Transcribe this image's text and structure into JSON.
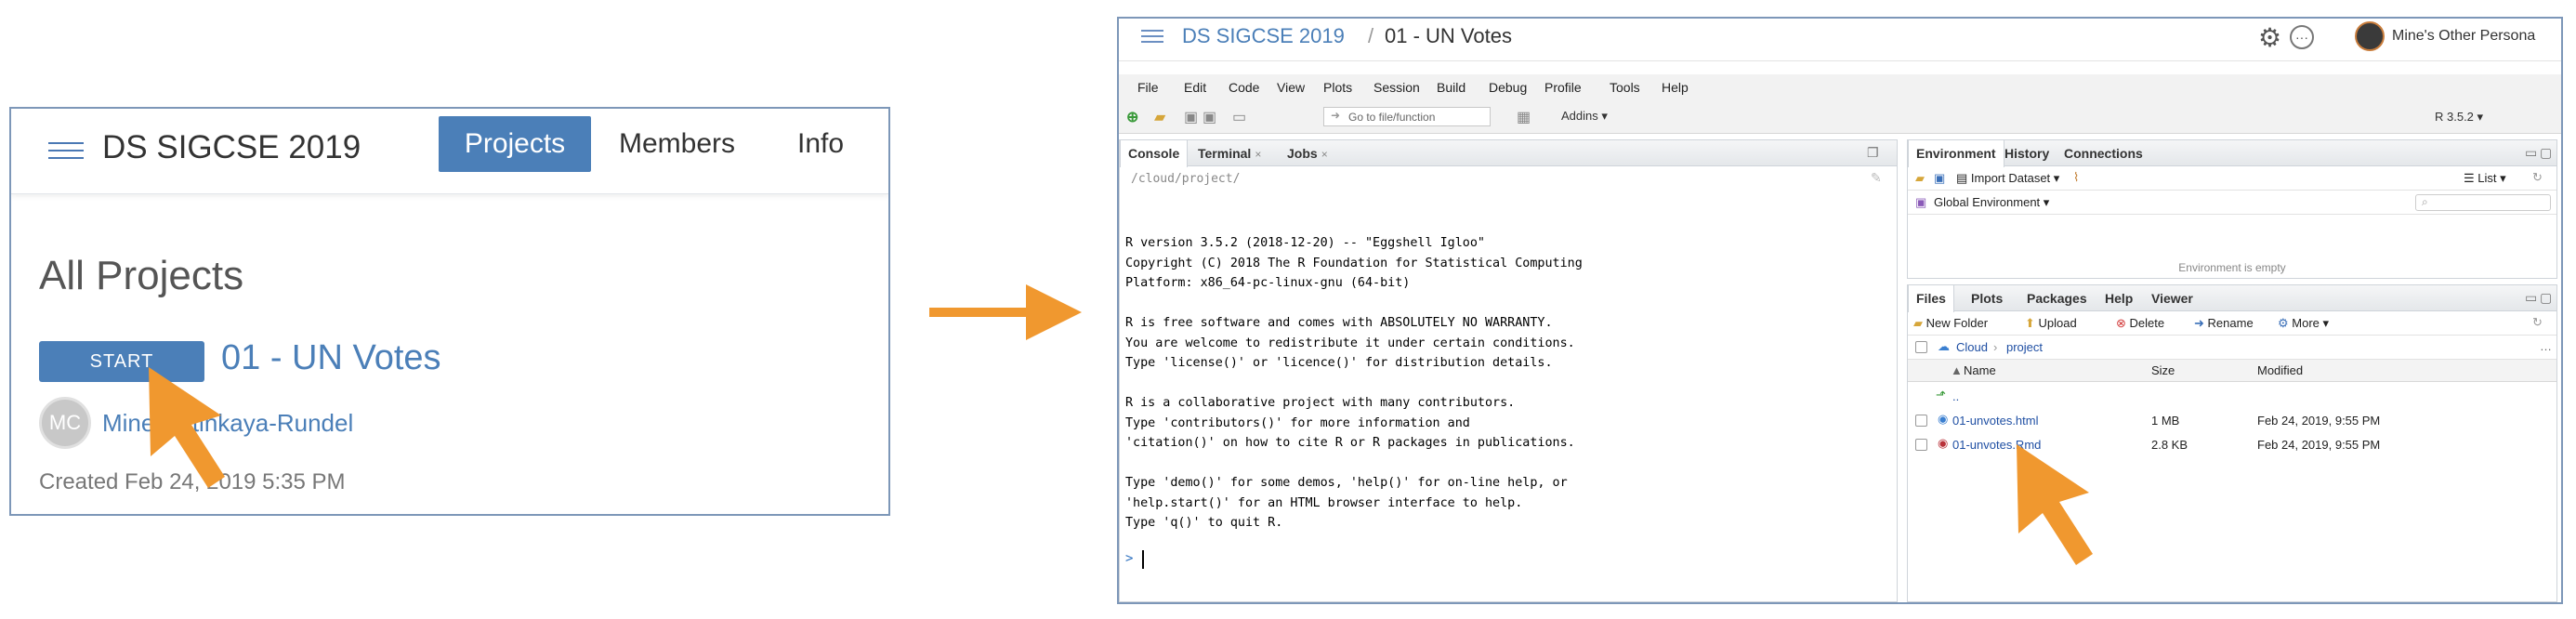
{
  "cloud": {
    "space_title": "DS SIGCSE 2019",
    "nav": {
      "projects": "Projects",
      "members": "Members",
      "info": "Info"
    },
    "heading": "All Projects",
    "project": {
      "start_label": "START",
      "name": "01 - UN Votes",
      "avatar_initials": "MC",
      "owner": "Mine Çetinkaya-Rundel",
      "created": "Created Feb 24, 2019 5:35 PM"
    }
  },
  "colors": {
    "accent": "#4b7fb8",
    "arrow": "#f0982f"
  },
  "ide": {
    "topbar": {
      "space": "DS SIGCSE 2019",
      "separator": "/",
      "project": "01 - UN Votes",
      "user": "Mine's Other Persona"
    },
    "menu": [
      "File",
      "Edit",
      "Code",
      "View",
      "Plots",
      "Session",
      "Build",
      "Debug",
      "Profile",
      "Tools",
      "Help"
    ],
    "toolbar": {
      "goto_placeholder": "Go to file/function",
      "addins": "Addins",
      "r_version": "R 3.5.2"
    },
    "console": {
      "tabs": [
        "Console",
        "Terminal",
        "Jobs"
      ],
      "path": "/cloud/project/",
      "lines": [
        "R version 3.5.2 (2018-12-20) -- \"Eggshell Igloo\"",
        "Copyright (C) 2018 The R Foundation for Statistical Computing",
        "Platform: x86_64-pc-linux-gnu (64-bit)",
        "",
        "R is free software and comes with ABSOLUTELY NO WARRANTY.",
        "You are welcome to redistribute it under certain conditions.",
        "Type 'license()' or 'licence()' for distribution details.",
        "",
        "R is a collaborative project with many contributors.",
        "Type 'contributors()' for more information and",
        "'citation()' on how to cite R or R packages in publications.",
        "",
        "Type 'demo()' for some demos, 'help()' for on-line help, or",
        "'help.start()' for an HTML browser interface to help.",
        "Type 'q()' to quit R."
      ],
      "prompt": ">"
    },
    "environment": {
      "tabs": [
        "Environment",
        "History",
        "Connections"
      ],
      "import_label": "Import Dataset",
      "list_label": "List",
      "scope": "Global Environment",
      "empty_text": "Environment is empty"
    },
    "files": {
      "tabs": [
        "Files",
        "Plots",
        "Packages",
        "Help",
        "Viewer"
      ],
      "toolbar": {
        "new_folder": "New Folder",
        "upload": "Upload",
        "delete": "Delete",
        "rename": "Rename",
        "more": "More"
      },
      "crumbs": [
        "Cloud",
        "project"
      ],
      "columns": {
        "name": "Name",
        "size": "Size",
        "modified": "Modified"
      },
      "parent": "..",
      "rows": [
        {
          "name": "01-unvotes.html",
          "size": "1 MB",
          "modified": "Feb 24, 2019, 9:55 PM",
          "icon": "html-file-icon"
        },
        {
          "name": "01-unvotes.Rmd",
          "size": "2.8 KB",
          "modified": "Feb 24, 2019, 9:55 PM",
          "icon": "rmd-file-icon"
        }
      ]
    }
  }
}
